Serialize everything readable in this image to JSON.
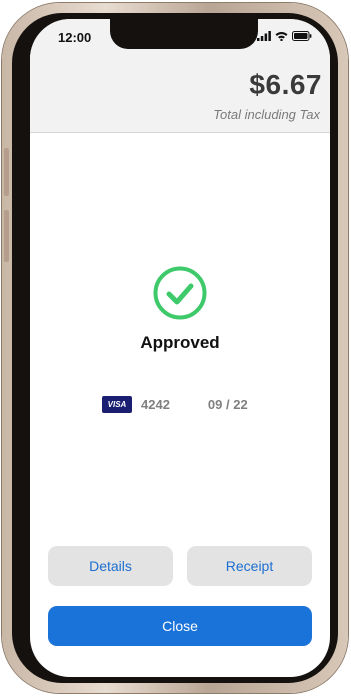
{
  "status_bar": {
    "time": "12:00"
  },
  "header": {
    "amount": "$6.67",
    "amount_caption": "Total including Tax"
  },
  "result": {
    "status": "Approved"
  },
  "card": {
    "brand": "VISA",
    "last4": "4242",
    "expiry": "09 / 22"
  },
  "actions": {
    "details_label": "Details",
    "receipt_label": "Receipt",
    "close_label": "Close"
  },
  "colors": {
    "success": "#3ec96a",
    "primary": "#1a73d9",
    "link": "#1c6fd1",
    "visa": "#1a1f71"
  }
}
